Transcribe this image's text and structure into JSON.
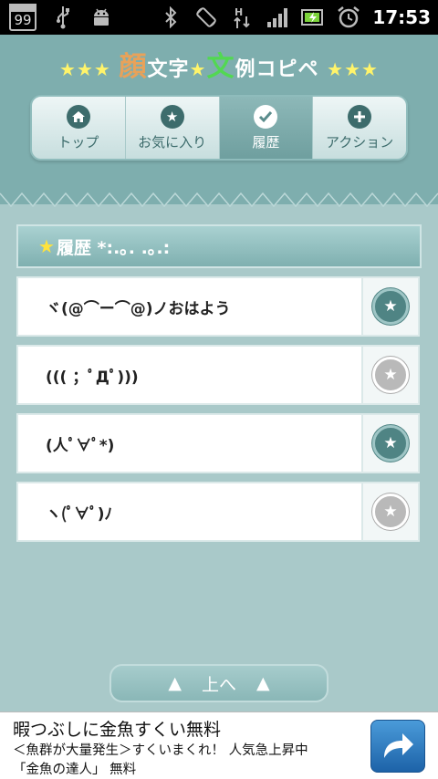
{
  "status_bar": {
    "calendar_day": "99",
    "time": "17:53",
    "icons": [
      "calendar-icon",
      "usb-icon",
      "android-debug-icon",
      "bluetooth-icon",
      "rotate-icon",
      "data-transfer-icon",
      "signal-icon",
      "battery-icon",
      "alarm-icon"
    ]
  },
  "header": {
    "title_left_stars": "★★★",
    "title_kao": "顔",
    "title_moji": "文字",
    "title_mid_star": "★",
    "title_bun": "文",
    "title_rei": "例コピペ",
    "title_right_stars": "★★★"
  },
  "tabs": [
    {
      "label": "トップ",
      "icon": "home-icon",
      "active": false
    },
    {
      "label": "お気に入り",
      "icon": "star-icon",
      "active": false
    },
    {
      "label": "履歴",
      "icon": "check-icon",
      "active": true
    },
    {
      "label": "アクション",
      "icon": "plus-icon",
      "active": false
    }
  ],
  "section": {
    "star": "★",
    "title": "履歴 *:.｡. .｡.:"
  },
  "history": [
    {
      "text": "ヾ(@⌒ー⌒@)ノおはよう",
      "favorite": true
    },
    {
      "text": "((( ；ﾟДﾟ)))",
      "favorite": false
    },
    {
      "text": "(人ﾟ∀ﾟ*)",
      "favorite": true
    },
    {
      "text": "ヽ(ﾟ∀ﾟ)ﾉ",
      "favorite": false
    }
  ],
  "to_top": {
    "left_arrow": "▲",
    "label": "上へ",
    "right_arrow": "▲"
  },
  "ad": {
    "line1": "暇つぶしに金魚すくい無料",
    "line2": "＜魚群が大量発生＞すくいまくれ！ 人気急上昇中",
    "line3": "「金魚の達人」 無料"
  },
  "colors": {
    "header_bg": "#7eaeae",
    "page_bg": "#a9c9c9",
    "accent_dark": "#3d6c6c",
    "star_yellow": "#ffe33b"
  }
}
